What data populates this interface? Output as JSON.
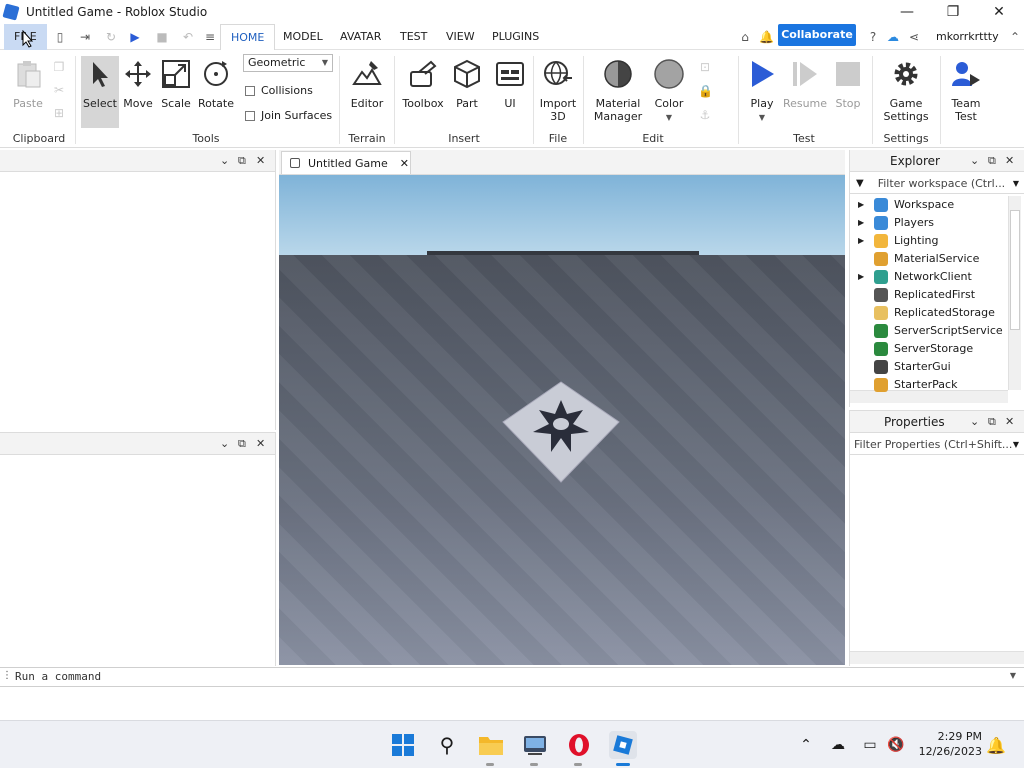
{
  "window": {
    "title": "Untitled Game - Roblox Studio",
    "minimize": "—",
    "maximize": "❐",
    "close": "✕"
  },
  "menu": {
    "tabs": [
      "FILE",
      "HOME",
      "MODEL",
      "AVATAR",
      "TEST",
      "VIEW",
      "PLUGINS"
    ],
    "active": "HOME",
    "collaborate": "Collaborate",
    "username": "mkorrkrttty"
  },
  "ribbon": {
    "clipboard": {
      "paste": "Paste",
      "group": "Clipboard"
    },
    "tools": {
      "select": "Select",
      "move": "Move",
      "scale": "Scale",
      "rotate": "Rotate",
      "group": "Tools",
      "geometric": "Geometric",
      "collisions": "Collisions",
      "join_surfaces": "Join Surfaces"
    },
    "terrain": {
      "editor": "Editor",
      "group": "Terrain"
    },
    "insert": {
      "toolbox": "Toolbox",
      "part": "Part",
      "ui": "UI",
      "group": "Insert"
    },
    "file": {
      "import_line1": "Import",
      "import_line2": "3D",
      "group": "File"
    },
    "edit": {
      "material_line1": "Material",
      "material_line2": "Manager",
      "color": "Color",
      "group": "Edit"
    },
    "test": {
      "play": "Play",
      "resume": "Resume",
      "stop": "Stop",
      "group": "Test"
    },
    "settings": {
      "game_line1": "Game",
      "game_line2": "Settings",
      "group": "Settings"
    },
    "team": {
      "line1": "Team",
      "line2": "Test"
    }
  },
  "viewport_tab": {
    "label": "Untitled Game"
  },
  "explorer": {
    "title": "Explorer",
    "filter_placeholder": "Filter workspace (Ctrl...",
    "items": [
      {
        "label": "Workspace",
        "expandable": true,
        "color": "#3a8ad8"
      },
      {
        "label": "Players",
        "expandable": true,
        "color": "#3a8ad8"
      },
      {
        "label": "Lighting",
        "expandable": true,
        "color": "#f2b63c"
      },
      {
        "label": "MaterialService",
        "expandable": false,
        "color": "#e0a030"
      },
      {
        "label": "NetworkClient",
        "expandable": true,
        "color": "#2f9f8f"
      },
      {
        "label": "ReplicatedFirst",
        "expandable": false,
        "color": "#555555"
      },
      {
        "label": "ReplicatedStorage",
        "expandable": false,
        "color": "#e8c060"
      },
      {
        "label": "ServerScriptService",
        "expandable": false,
        "color": "#2b8a3e"
      },
      {
        "label": "ServerStorage",
        "expandable": false,
        "color": "#2b8a3e"
      },
      {
        "label": "StarterGui",
        "expandable": false,
        "color": "#444444"
      },
      {
        "label": "StarterPack",
        "expandable": false,
        "color": "#e0a030"
      }
    ]
  },
  "properties": {
    "title": "Properties",
    "filter_placeholder": "Filter Properties (Ctrl+Shift..."
  },
  "command_bar": {
    "placeholder": "Run a command"
  },
  "taskbar": {
    "time": "2:29 PM",
    "date": "12/26/2023"
  }
}
